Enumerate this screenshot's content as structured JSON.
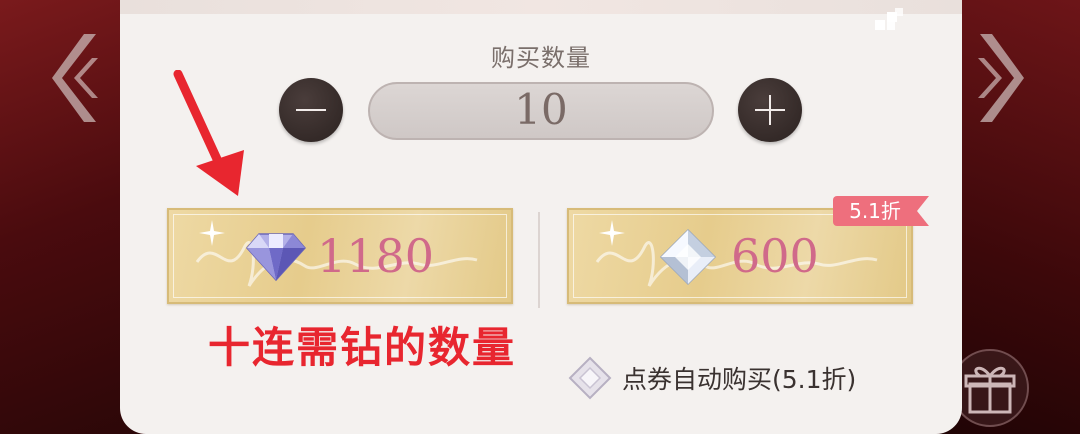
{
  "title": "购买数量",
  "quantity": {
    "value": "10",
    "minus_icon": "minus-icon",
    "plus_icon": "plus-icon"
  },
  "options": [
    {
      "price": "1180",
      "currency_icon": "diamond-icon"
    },
    {
      "price": "600",
      "currency_icon": "voucher-crystal-icon",
      "badge": "5.1折"
    }
  ],
  "annotation": "十连需钻的数量",
  "auto_buy": {
    "label": "点券自动购买(5.1折)"
  },
  "colors": {
    "panel": "#f4f1ef",
    "price_text": "#d0698a",
    "badge": "#ee6f7d",
    "annotation": "#e8262f"
  }
}
